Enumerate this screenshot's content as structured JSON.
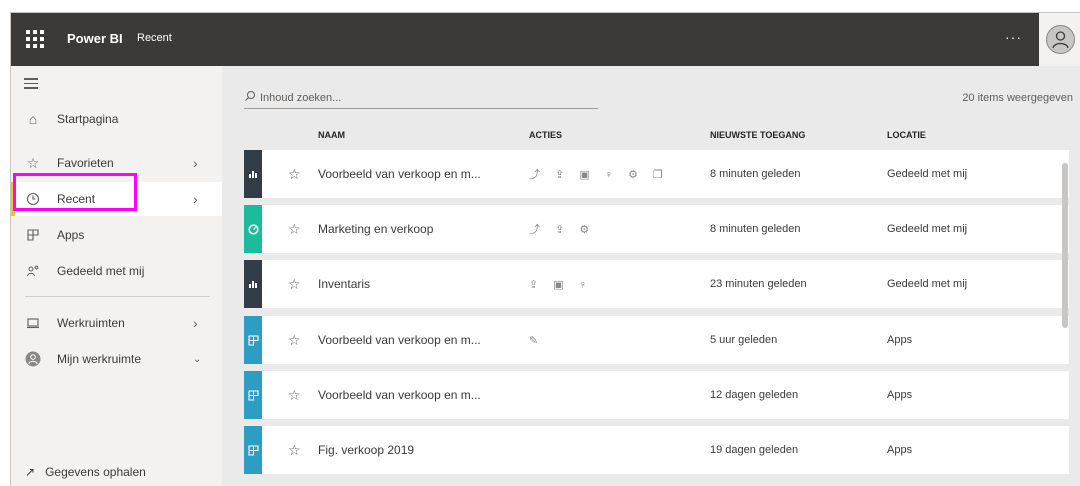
{
  "topbar": {
    "app_name": "Power BI",
    "breadcrumb": "Recent",
    "more": "···"
  },
  "sidebar": {
    "items": [
      {
        "label": "Startpagina",
        "icon": "home-icon"
      },
      {
        "label": "Favorieten",
        "icon": "star-icon"
      },
      {
        "label": "Recent",
        "icon": "clock-icon"
      },
      {
        "label": "Apps",
        "icon": "apps-icon"
      },
      {
        "label": "Gedeeld met mij",
        "icon": "shared-icon"
      },
      {
        "label": "Werkruimten",
        "icon": "workspaces-icon"
      },
      {
        "label": "Mijn werkruimte",
        "icon": "my-workspace-icon"
      }
    ],
    "active_index": 2,
    "get_data": "Gegevens ophalen"
  },
  "search": {
    "placeholder": "Inhoud zoeken..."
  },
  "count_text": "20 items weergegeven",
  "table": {
    "columns": [
      "NAAM",
      "ACTIES",
      "NIEUWSTE TOEGANG",
      "LOCATIE"
    ],
    "rows": [
      {
        "name": "Voorbeeld van verkoop en m...",
        "type": "report",
        "color": "#333d47",
        "actions": "⤴ ⇪ ▣ ♀ ⚙ ❐",
        "time": "8 minuten geleden",
        "location": "Gedeeld met mij"
      },
      {
        "name": "Marketing en verkoop",
        "type": "dashboard",
        "color": "#1bbc9b",
        "actions": "⤴ ⇪ ⚙",
        "time": "8 minuten geleden",
        "location": "Gedeeld met mij"
      },
      {
        "name": "Inventaris",
        "type": "report",
        "color": "#333d47",
        "actions": "⇪ ▣ ♀",
        "time": "23 minuten geleden",
        "location": "Gedeeld met mij"
      },
      {
        "name": "Voorbeeld van verkoop en m...",
        "type": "app",
        "color": "#2d9dc4",
        "actions": "✎",
        "time": "5 uur geleden",
        "location": "Apps"
      },
      {
        "name": "Voorbeeld van verkoop en m...",
        "type": "app",
        "color": "#2d9dc4",
        "actions": "",
        "time": "12 dagen geleden",
        "location": "Apps"
      },
      {
        "name": "Fig. verkoop 2019",
        "type": "app",
        "color": "#2d9dc4",
        "actions": "",
        "time": "19 dagen geleden",
        "location": "Apps"
      }
    ]
  }
}
